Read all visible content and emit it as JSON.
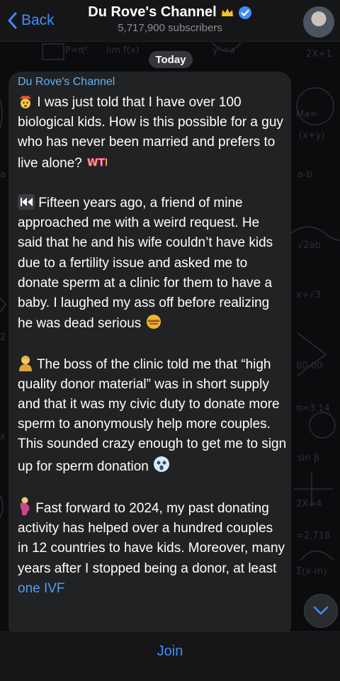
{
  "header": {
    "back_label": "Back",
    "channel_title": "Du Rove's Channel",
    "subscribers": "5,717,900 subscribers"
  },
  "chat": {
    "date_label": "Today",
    "message": {
      "sender": "Du Rove's Channel",
      "paragraphs": [
        "I was just told that I have over 100 biological kids. How is this possible for a guy who has never been married and prefers to live alone?",
        "Fifteen years ago, a friend of mine approached me with a weird request. He said that he and his wife couldn’t have kids due to a fertility issue and asked me to donate sperm at a clinic for them to have a baby. I laughed my ass off before realizing he was dead serious",
        "The boss of the clinic told me that “high quality donor material” was in short supply and that it was my civic duty to donate more sperm to anonymously help more couples. This sounded crazy enough to get me to sign up for sperm donation",
        "Fast forward to 2024, my past donating activity has helped over a hundred couples in 12 countries to have kids. Moreover, many years after I stopped being a donor, at least",
        "one IVF"
      ],
      "emoji_labels": {
        "wtf": "WTF"
      }
    }
  },
  "footer": {
    "join_label": "Join"
  },
  "colors": {
    "accent": "#3e8ef7",
    "sender": "#65b2ef",
    "bubble": "#212224",
    "bar": "#161618"
  },
  "icons": [
    "chevron-left-icon",
    "crown-icon",
    "verified-badge-icon",
    "exploding-head-icon",
    "wtf-sticker-icon",
    "rewind-icon",
    "no-mouth-icon",
    "person-icon",
    "scream-ghost-icon",
    "pregnant-icon",
    "chevron-down-icon"
  ]
}
